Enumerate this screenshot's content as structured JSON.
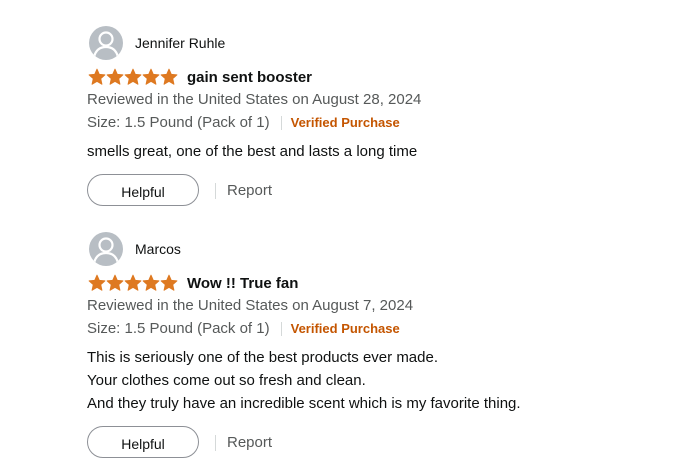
{
  "colors": {
    "star": "#de7921",
    "verified": "#c45500",
    "meta_text": "#565959",
    "body_text": "#0f1111",
    "avatar_bg": "#b8bec4"
  },
  "reviews": [
    {
      "reviewer": "Jennifer Ruhle",
      "avatar_icon": "default-user-icon",
      "rating": 5,
      "rating_max": 5,
      "title": "gain sent booster",
      "date": "Reviewed in the United States on August 28, 2024",
      "size": "Size: 1.5 Pound (Pack of 1)",
      "verified": "Verified Purchase",
      "body": [
        "smells great, one of the best and lasts a long time"
      ],
      "helpful_label": "Helpful",
      "report_label": "Report"
    },
    {
      "reviewer": "Marcos",
      "avatar_icon": "default-user-icon",
      "rating": 5,
      "rating_max": 5,
      "title": "Wow !! True fan",
      "date": "Reviewed in the United States on August 7, 2024",
      "size": "Size: 1.5 Pound (Pack of 1)",
      "verified": "Verified Purchase",
      "body": [
        "This is seriously one of the best products ever made.",
        "Your clothes come out so fresh and clean.",
        "And they truly have an incredible scent which is my favorite thing."
      ],
      "helpful_label": "Helpful",
      "report_label": "Report"
    }
  ]
}
